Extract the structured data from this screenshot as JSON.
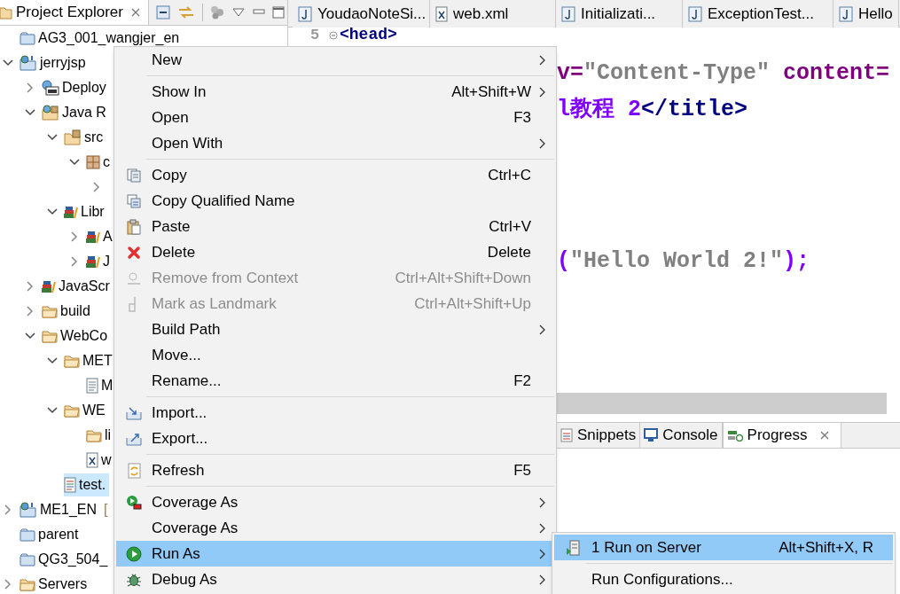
{
  "explorer": {
    "title": "Project Explorer",
    "tree": [
      {
        "label": "AG3_001_wangjer_en",
        "selected": false
      },
      {
        "label": "jerryjsp",
        "expanded": true,
        "selected": false,
        "children": [
          {
            "label": "Deploy",
            "expanded": false,
            "selected": false
          },
          {
            "label": "Java R",
            "expanded": true,
            "selected": false,
            "children": [
              {
                "label": "src",
                "expanded": true,
                "selected": false,
                "children": [
                  {
                    "label": "c",
                    "expanded": true,
                    "selected": false,
                    "children": [
                      {
                        "expanded": false
                      }
                    ]
                  }
                ]
              },
              {
                "label": "Libr",
                "expanded": true,
                "selected": false,
                "children": [
                  {
                    "label": "A",
                    "expanded": false,
                    "selected": false
                  },
                  {
                    "label": "J",
                    "expanded": false,
                    "selected": false
                  }
                ]
              }
            ]
          },
          {
            "label": "JavaScr",
            "expanded": false,
            "selected": false
          },
          {
            "label": "build",
            "expanded": false,
            "selected": false
          },
          {
            "label": "WebCo",
            "expanded": true,
            "selected": false,
            "children": [
              {
                "label": "MET",
                "expanded": true,
                "selected": false,
                "children": [
                  {
                    "label": "M",
                    "selected": false
                  }
                ]
              },
              {
                "label": "WE",
                "expanded": true,
                "selected": false,
                "children": [
                  {
                    "label": "li",
                    "selected": false
                  },
                  {
                    "label": "w",
                    "selected": false
                  }
                ]
              },
              {
                "label": "test.",
                "selected": true
              }
            ]
          }
        ]
      },
      {
        "label": "ME1_EN",
        "decoration": "[",
        "expanded": false,
        "selected": false
      },
      {
        "label": "parent",
        "selected": false
      },
      {
        "label": "QG3_504_",
        "selected": false
      },
      {
        "label": "Servers",
        "expanded": false,
        "selected": false
      }
    ]
  },
  "editor": {
    "tabs": [
      {
        "label": "YoudaoNoteSi...",
        "kind": "java",
        "selected": false
      },
      {
        "label": "web.xml",
        "kind": "xml",
        "selected": false
      },
      {
        "label": "Initializati...",
        "kind": "java",
        "selected": false
      },
      {
        "label": "ExceptionTest...",
        "kind": "java",
        "selected": false
      },
      {
        "label": "Hello",
        "kind": "java",
        "selected": false
      }
    ],
    "lines": [
      {
        "number": "5",
        "folded": false,
        "segments": [
          {
            "text": "<head>",
            "kind": "tag"
          }
        ]
      },
      {
        "segments": [
          {
            "text": "v=",
            "kind": "attr"
          },
          {
            "text": "\"Content-Type\"",
            "kind": "string"
          },
          {
            "text": " content=",
            "kind": "attr"
          }
        ]
      },
      {
        "segments": [
          {
            "text": "l教程 2",
            "kind": "text"
          },
          {
            "text": "</title>",
            "kind": "tag"
          }
        ]
      },
      {
        "segments": [
          {
            "text": "(",
            "kind": "punct"
          },
          {
            "text": "\"Hello World 2!\"",
            "kind": "string"
          },
          {
            "text": ");",
            "kind": "punct"
          }
        ]
      }
    ]
  },
  "panel": {
    "tabs": [
      {
        "label": "Snippets",
        "selected": false
      },
      {
        "label": "Console",
        "selected": false
      },
      {
        "label": "Progress",
        "selected": true
      }
    ]
  },
  "context_menu": {
    "items": [
      {
        "kind": "item",
        "label": "New",
        "has_submenu": true,
        "disabled": false,
        "selected": false
      },
      {
        "kind": "separator"
      },
      {
        "kind": "item",
        "label": "Show In",
        "shortcut": "Alt+Shift+W",
        "has_submenu": true,
        "disabled": false,
        "selected": false
      },
      {
        "kind": "item",
        "label": "Open",
        "shortcut": "F3",
        "has_submenu": false,
        "disabled": false,
        "selected": false
      },
      {
        "kind": "item",
        "label": "Open With",
        "has_submenu": true,
        "disabled": false,
        "selected": false
      },
      {
        "kind": "separator"
      },
      {
        "kind": "item",
        "label": "Copy",
        "shortcut": "Ctrl+C",
        "has_submenu": false,
        "disabled": false,
        "selected": false
      },
      {
        "kind": "item",
        "label": "Copy Qualified Name",
        "has_submenu": false,
        "disabled": false,
        "selected": false
      },
      {
        "kind": "item",
        "label": "Paste",
        "shortcut": "Ctrl+V",
        "has_submenu": false,
        "disabled": false,
        "selected": false
      },
      {
        "kind": "item",
        "label": "Delete",
        "shortcut": "Delete",
        "has_submenu": false,
        "disabled": false,
        "selected": false
      },
      {
        "kind": "item",
        "label": "Remove from Context",
        "shortcut": "Ctrl+Alt+Shift+Down",
        "has_submenu": false,
        "disabled": true,
        "selected": false
      },
      {
        "kind": "item",
        "label": "Mark as Landmark",
        "shortcut": "Ctrl+Alt+Shift+Up",
        "has_submenu": false,
        "disabled": true,
        "selected": false
      },
      {
        "kind": "item",
        "label": "Build Path",
        "has_submenu": true,
        "disabled": false,
        "selected": false
      },
      {
        "kind": "item",
        "label": "Move...",
        "has_submenu": false,
        "disabled": false,
        "selected": false
      },
      {
        "kind": "item",
        "label": "Rename...",
        "shortcut": "F2",
        "has_submenu": false,
        "disabled": false,
        "selected": false
      },
      {
        "kind": "separator"
      },
      {
        "kind": "item",
        "label": "Import...",
        "has_submenu": false,
        "disabled": false,
        "selected": false
      },
      {
        "kind": "item",
        "label": "Export...",
        "has_submenu": false,
        "disabled": false,
        "selected": false
      },
      {
        "kind": "separator"
      },
      {
        "kind": "item",
        "label": "Refresh",
        "shortcut": "F5",
        "has_submenu": false,
        "disabled": false,
        "selected": false
      },
      {
        "kind": "separator"
      },
      {
        "kind": "item",
        "label": "Coverage As",
        "has_submenu": true,
        "disabled": false,
        "selected": false
      },
      {
        "kind": "item",
        "label": "Coverage As",
        "has_submenu": true,
        "disabled": false,
        "selected": false
      },
      {
        "kind": "item",
        "label": "Run As",
        "has_submenu": true,
        "disabled": false,
        "selected": true
      },
      {
        "kind": "item",
        "label": "Debug As",
        "has_submenu": true,
        "disabled": false,
        "selected": false
      }
    ]
  },
  "submenu": {
    "items": [
      {
        "kind": "item",
        "label": "1 Run on Server",
        "shortcut": "Alt+Shift+X, R",
        "selected": true
      },
      {
        "kind": "separator"
      },
      {
        "kind": "item",
        "label": "Run Configurations...",
        "selected": false
      }
    ]
  }
}
